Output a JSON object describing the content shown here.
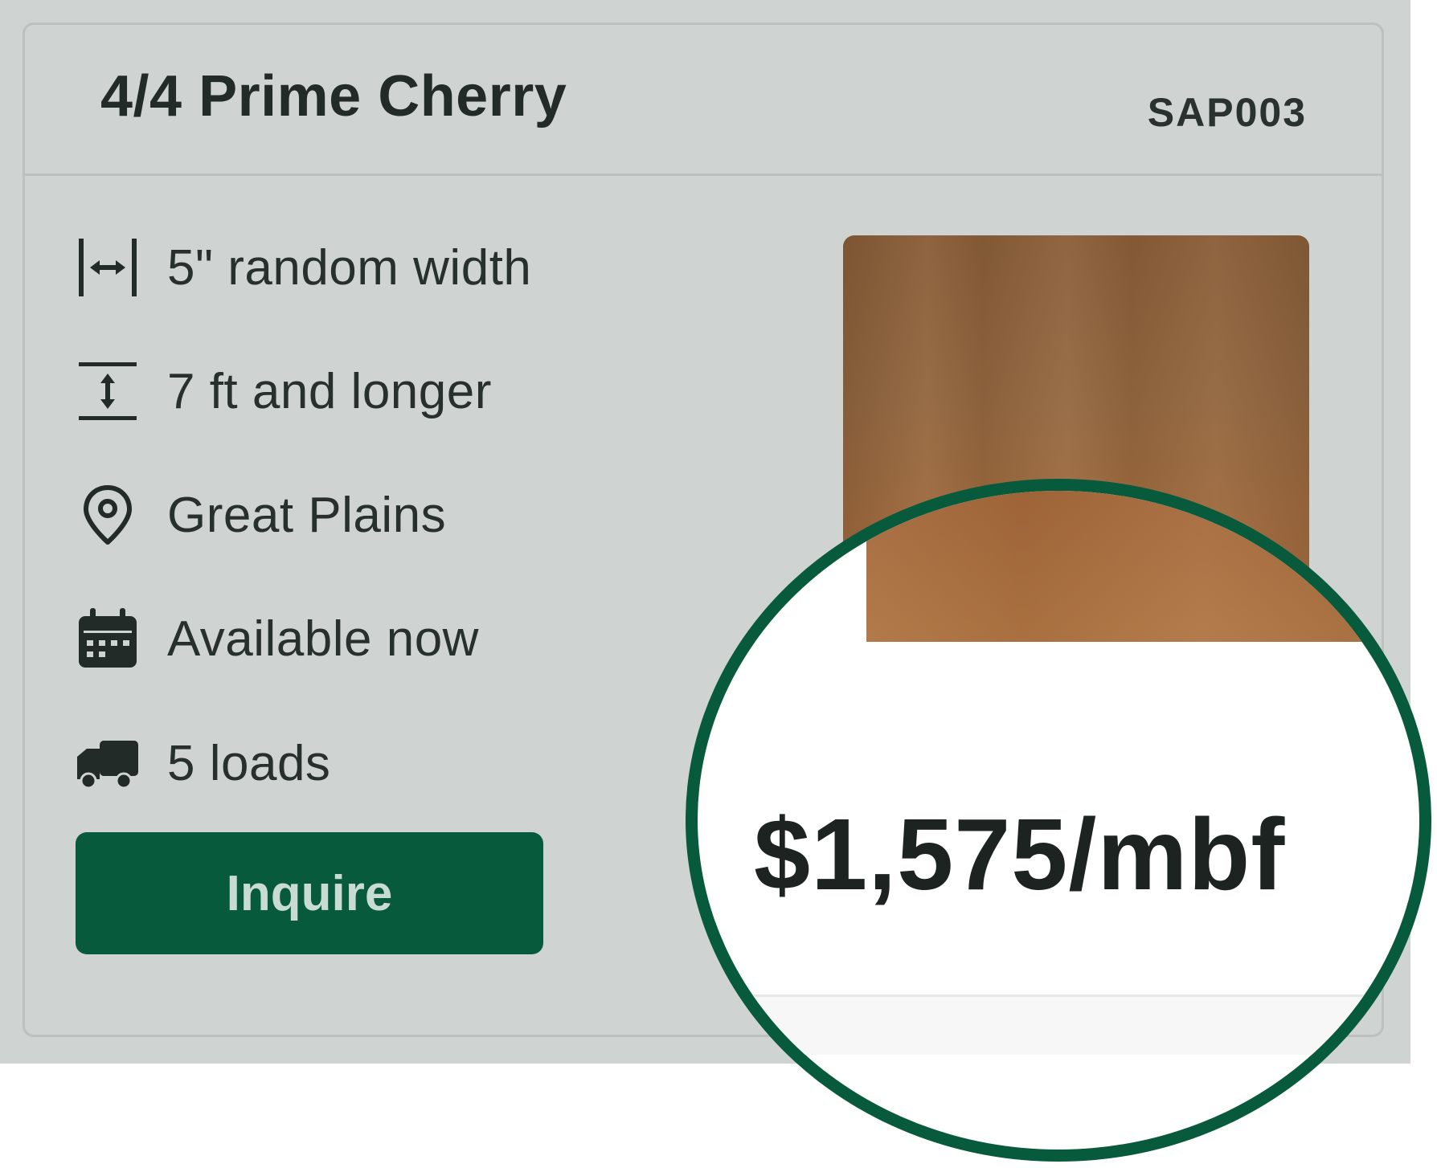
{
  "product": {
    "title": "4/4 Prime Cherry",
    "sku": "SAP003"
  },
  "specs": [
    {
      "icon": "width-arrows-icon",
      "label": "5\" random width"
    },
    {
      "icon": "length-arrows-icon",
      "label": "7 ft and longer"
    },
    {
      "icon": "location-pin-icon",
      "label": "Great Plains"
    },
    {
      "icon": "calendar-icon",
      "label": "Available now"
    },
    {
      "icon": "truck-icon",
      "label": "5 loads"
    }
  ],
  "actions": {
    "inquire_label": "Inquire"
  },
  "magnifier": {
    "price": "$1,575/mbf"
  },
  "colors": {
    "brand_green": "#075a3c",
    "card_background": "#cfd3d1",
    "wood": "#93673f"
  }
}
